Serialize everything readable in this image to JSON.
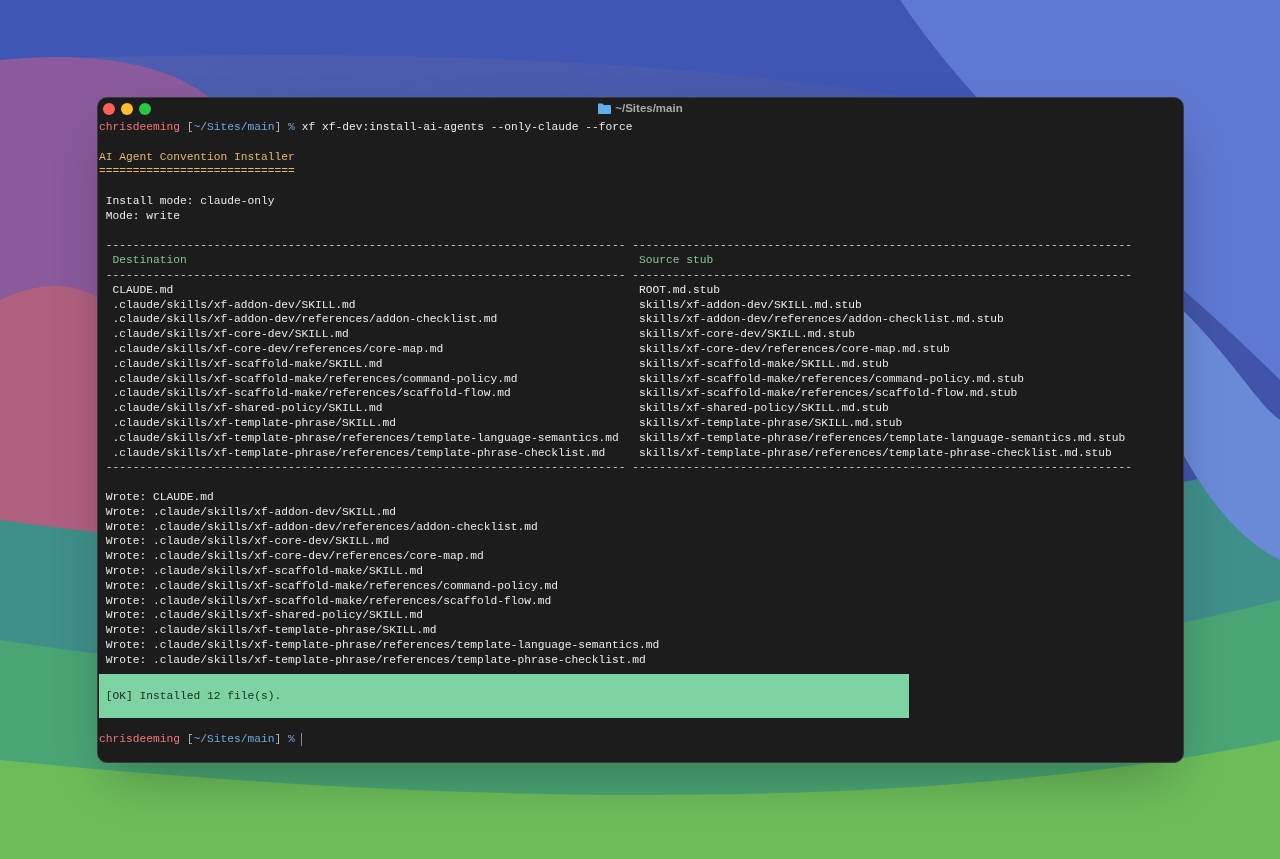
{
  "window": {
    "title": "~/Sites/main"
  },
  "terminal": {
    "command_line": [
      {
        "text": "chrisdeeming",
        "kind": "user"
      },
      {
        "text": "[",
        "kind": "bracket"
      },
      {
        "text": "~/Sites/main",
        "kind": "path"
      },
      {
        "text": "]",
        "kind": "bracket"
      },
      {
        "text": "%",
        "kind": "symbol"
      },
      {
        "text": "xf xf-dev:install-ai-agents --only-claude --force",
        "kind": "command"
      }
    ],
    "heading": "AI Agent Convention Installer",
    "heading_rule": "=============================",
    "info": [
      "Install mode: claude-only",
      "Mode: write"
    ],
    "table": {
      "rule_top": [
        "-----------------------------------------------------------------------------",
        "--------------------------------------------------------------------------"
      ],
      "columns": [
        "Destination",
        "Source stub"
      ],
      "rule_mid": [
        "-----------------------------------------------------------------------------",
        "--------------------------------------------------------------------------"
      ],
      "rows": [
        [
          "CLAUDE.md",
          "ROOT.md.stub"
        ],
        [
          ".claude/skills/xf-addon-dev/SKILL.md",
          "skills/xf-addon-dev/SKILL.md.stub"
        ],
        [
          ".claude/skills/xf-addon-dev/references/addon-checklist.md",
          "skills/xf-addon-dev/references/addon-checklist.md.stub"
        ],
        [
          ".claude/skills/xf-core-dev/SKILL.md",
          "skills/xf-core-dev/SKILL.md.stub"
        ],
        [
          ".claude/skills/xf-core-dev/references/core-map.md",
          "skills/xf-core-dev/references/core-map.md.stub"
        ],
        [
          ".claude/skills/xf-scaffold-make/SKILL.md",
          "skills/xf-scaffold-make/SKILL.md.stub"
        ],
        [
          ".claude/skills/xf-scaffold-make/references/command-policy.md",
          "skills/xf-scaffold-make/references/command-policy.md.stub"
        ],
        [
          ".claude/skills/xf-scaffold-make/references/scaffold-flow.md",
          "skills/xf-scaffold-make/references/scaffold-flow.md.stub"
        ],
        [
          ".claude/skills/xf-shared-policy/SKILL.md",
          "skills/xf-shared-policy/SKILL.md.stub"
        ],
        [
          ".claude/skills/xf-template-phrase/SKILL.md",
          "skills/xf-template-phrase/SKILL.md.stub"
        ],
        [
          ".claude/skills/xf-template-phrase/references/template-language-semantics.md",
          "skills/xf-template-phrase/references/template-language-semantics.md.stub"
        ],
        [
          ".claude/skills/xf-template-phrase/references/template-phrase-checklist.md",
          "skills/xf-template-phrase/references/template-phrase-checklist.md.stub"
        ]
      ],
      "rule_bottom": [
        "-----------------------------------------------------------------------------",
        "--------------------------------------------------------------------------"
      ]
    },
    "log": [
      "Wrote: CLAUDE.md",
      "Wrote: .claude/skills/xf-addon-dev/SKILL.md",
      "Wrote: .claude/skills/xf-addon-dev/references/addon-checklist.md",
      "Wrote: .claude/skills/xf-core-dev/SKILL.md",
      "Wrote: .claude/skills/xf-core-dev/references/core-map.md",
      "Wrote: .claude/skills/xf-scaffold-make/SKILL.md",
      "Wrote: .claude/skills/xf-scaffold-make/references/command-policy.md",
      "Wrote: .claude/skills/xf-scaffold-make/references/scaffold-flow.md",
      "Wrote: .claude/skills/xf-shared-policy/SKILL.md",
      "Wrote: .claude/skills/xf-template-phrase/SKILL.md",
      "Wrote: .claude/skills/xf-template-phrase/references/template-language-semantics.md",
      "Wrote: .claude/skills/xf-template-phrase/references/template-phrase-checklist.md"
    ],
    "result": "[OK] Installed 12 file(s).",
    "prompt": {
      "parts": [
        {
          "text": "chrisdeeming",
          "kind": "user"
        },
        {
          "text": "[",
          "kind": "bracket"
        },
        {
          "text": "~/Sites/main",
          "kind": "path"
        },
        {
          "text": "]",
          "kind": "bracket"
        },
        {
          "text": "%",
          "kind": "symbol"
        }
      ],
      "cursor": true
    }
  }
}
